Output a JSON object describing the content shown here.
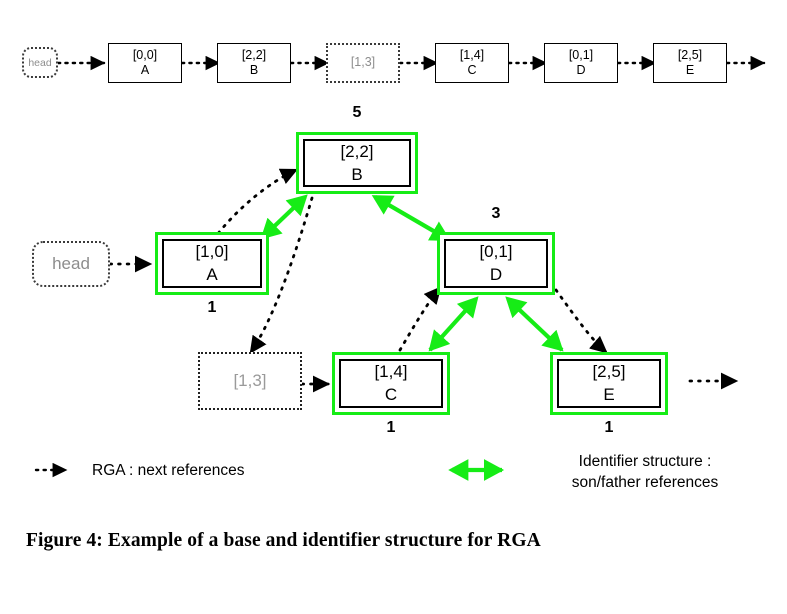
{
  "figure": {
    "caption": "Figure 4: Example of a base and identifier structure for RGA"
  },
  "colors": {
    "identifier_green": "#16ec16",
    "node_border": "#000000",
    "tombstone_text": "#9a9a9a",
    "tombstone_border": "#222222",
    "background": "#ffffff"
  },
  "base_chain": {
    "head": {
      "label": "head"
    },
    "nodes": [
      {
        "id": "[0,0]",
        "value": "A",
        "tombstone": false
      },
      {
        "id": "[2,2]",
        "value": "B",
        "tombstone": false
      },
      {
        "id": "[1,3]",
        "value": "",
        "tombstone": true
      },
      {
        "id": "[1,4]",
        "value": "C",
        "tombstone": false
      },
      {
        "id": "[0,1]",
        "value": "D",
        "tombstone": false
      },
      {
        "id": "[2,5]",
        "value": "E",
        "tombstone": false
      }
    ]
  },
  "identifier_tree": {
    "head": {
      "label": "head"
    },
    "nodes": [
      {
        "key": "A",
        "id": "[1,0]",
        "value": "A",
        "weight": "1",
        "tombstone": false
      },
      {
        "key": "B",
        "id": "[2,2]",
        "value": "B",
        "weight": "5",
        "tombstone": false
      },
      {
        "key": "T",
        "id": "[1,3]",
        "value": "",
        "weight": "",
        "tombstone": true
      },
      {
        "key": "C",
        "id": "[1,4]",
        "value": "C",
        "weight": "1",
        "tombstone": false
      },
      {
        "key": "D",
        "id": "[0,1]",
        "value": "D",
        "weight": "3",
        "tombstone": false
      },
      {
        "key": "E",
        "id": "[2,5]",
        "value": "E",
        "weight": "1",
        "tombstone": false
      }
    ],
    "son_father_edges": [
      {
        "from": "B",
        "to": "A"
      },
      {
        "from": "B",
        "to": "D"
      },
      {
        "from": "D",
        "to": "C"
      },
      {
        "from": "D",
        "to": "E"
      }
    ],
    "next_edges": [
      {
        "from": "head",
        "to": "A"
      },
      {
        "from": "A",
        "to": "B"
      },
      {
        "from": "B",
        "to": "T"
      },
      {
        "from": "T",
        "to": "C"
      },
      {
        "from": "C",
        "to": "D"
      },
      {
        "from": "D",
        "to": "E"
      },
      {
        "from": "E",
        "to": "out"
      }
    ]
  },
  "legend": {
    "next_label": "RGA : next references",
    "identifier_label_line1": "Identifier structure :",
    "identifier_label_line2": "son/father references"
  }
}
